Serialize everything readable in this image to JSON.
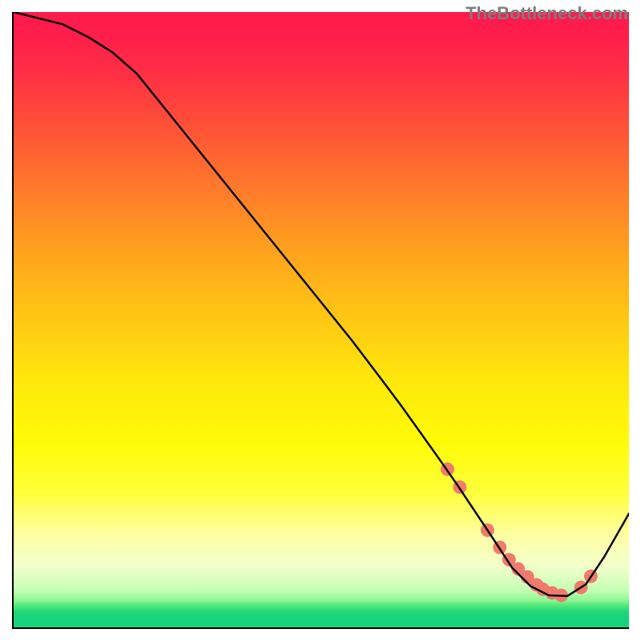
{
  "watermark": "TheBottleneck.com",
  "chart_data": {
    "type": "line",
    "title": "",
    "xlabel": "",
    "ylabel": "",
    "xlim": [
      0,
      100
    ],
    "ylim": [
      0,
      100
    ],
    "grid": false,
    "gradient_stops": [
      {
        "offset": 0.0,
        "color": "#ff1a4d"
      },
      {
        "offset": 0.04,
        "color": "#ff1e4a"
      },
      {
        "offset": 0.1,
        "color": "#ff2f44"
      },
      {
        "offset": 0.2,
        "color": "#ff5735"
      },
      {
        "offset": 0.3,
        "color": "#ff7f29"
      },
      {
        "offset": 0.4,
        "color": "#ffa61c"
      },
      {
        "offset": 0.5,
        "color": "#ffc813"
      },
      {
        "offset": 0.6,
        "color": "#ffe80c"
      },
      {
        "offset": 0.7,
        "color": "#fffb07"
      },
      {
        "offset": 0.78,
        "color": "#ffff3a"
      },
      {
        "offset": 0.85,
        "color": "#ffffa2"
      },
      {
        "offset": 0.9,
        "color": "#f2ffca"
      },
      {
        "offset": 0.94,
        "color": "#c4ffb4"
      },
      {
        "offset": 0.955,
        "color": "#92f894"
      },
      {
        "offset": 0.965,
        "color": "#4fe77a"
      },
      {
        "offset": 0.975,
        "color": "#1fd877"
      },
      {
        "offset": 0.985,
        "color": "#19d37c"
      },
      {
        "offset": 1.0,
        "color": "#19d37c"
      }
    ],
    "series": [
      {
        "name": "bottleneck-curve",
        "color": "#000000",
        "x": [
          0,
          4,
          8,
          12,
          16,
          20,
          25,
          30,
          35,
          40,
          45,
          50,
          55,
          60,
          63,
          66,
          69,
          72,
          75,
          78,
          81,
          84,
          87,
          90,
          93,
          96,
          100
        ],
        "y": [
          100,
          99,
          98,
          96,
          93.5,
          90,
          83.8,
          77.6,
          71.4,
          65.2,
          59,
          52.8,
          46.6,
          40,
          36,
          31.8,
          27.6,
          23.3,
          18.8,
          14.3,
          9.7,
          6.7,
          5.2,
          5.1,
          7.0,
          11.5,
          18.5
        ]
      }
    ],
    "markers": {
      "name": "trough-dots",
      "color": "#ee7b6b",
      "radius_pct": 1.1,
      "x": [
        70.5,
        72.5,
        77.0,
        79.0,
        80.5,
        82.0,
        83.5,
        85.0,
        86.0,
        87.5,
        89.0,
        92.2,
        93.8
      ],
      "y": [
        25.7,
        22.8,
        15.8,
        13.0,
        11.0,
        9.5,
        8.2,
        6.9,
        6.2,
        5.6,
        5.2,
        6.5,
        8.3
      ]
    }
  }
}
